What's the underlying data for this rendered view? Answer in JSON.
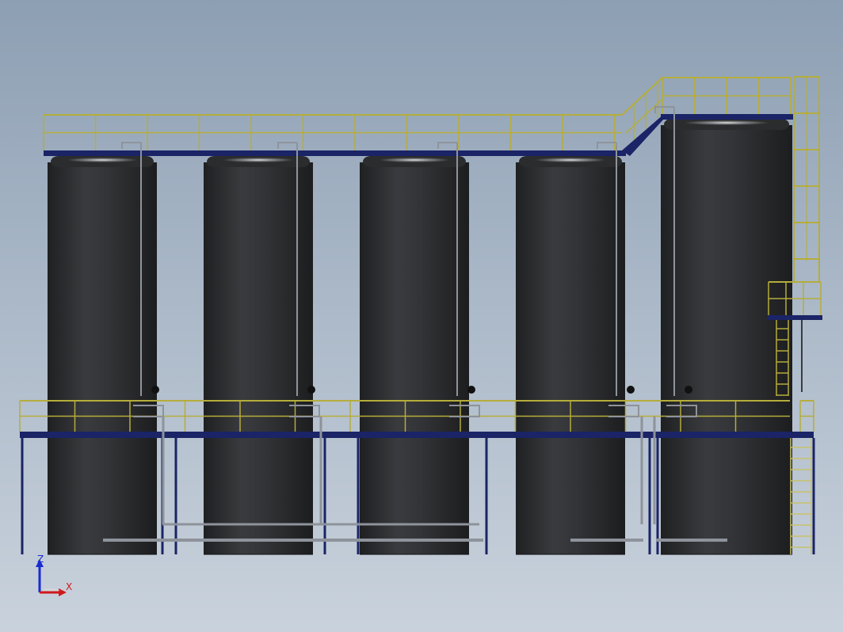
{
  "colors": {
    "background_top": "#8d9fb3",
    "background_bottom": "#c9d2dc",
    "tank_body": "#2b2c2e",
    "tank_highlight": "#4a4c50",
    "railing": "#b5ad3a",
    "platform": "#1a2466",
    "pipe": "#8e939b",
    "axis_z": "#1a2bd0",
    "axis_x": "#d01a1a",
    "axis_y_plane": "#d8d8d8"
  },
  "triad": {
    "z_label": "Z",
    "x_label": "X"
  }
}
